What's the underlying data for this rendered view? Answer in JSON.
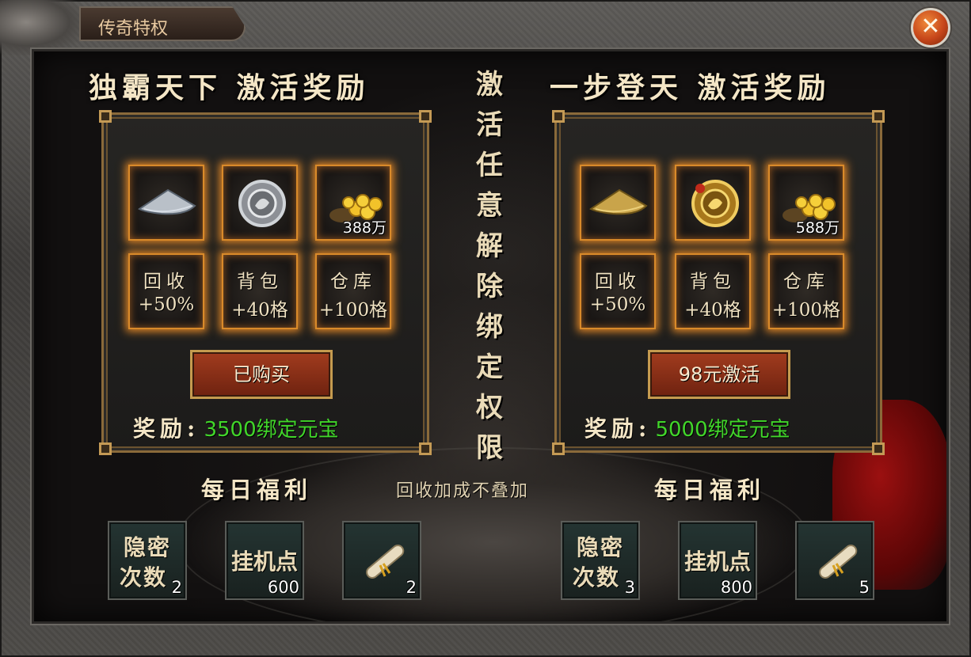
{
  "window": {
    "title": "传奇特权",
    "close_icon": "close-x-icon"
  },
  "center_notice": [
    "激",
    "活",
    "任",
    "意",
    "解",
    "除",
    "绑",
    "定",
    "权",
    "限"
  ],
  "note": "回收加成不叠加",
  "panels": [
    {
      "title": "独霸天下 激活奖励",
      "items": [
        {
          "icon": "silver-hat-icon"
        },
        {
          "icon": "silver-medal-icon"
        },
        {
          "icon": "gold-coins-icon",
          "amount": "388万"
        }
      ],
      "perks": [
        {
          "line1": "回收",
          "line2": "+50%"
        },
        {
          "line1": "背包",
          "line2": "+40格"
        },
        {
          "line1": "仓库",
          "line2": "+100格"
        }
      ],
      "button": "已购买",
      "reward_label": "奖励:",
      "reward_value": "3500绑定元宝",
      "daily_title": "每日福利",
      "daily": [
        {
          "line1": "隐密",
          "line2": "次数",
          "count": "2"
        },
        {
          "line1": "挂机点",
          "count": "600"
        },
        {
          "icon": "scroll-icon",
          "count": "2"
        }
      ]
    },
    {
      "title": "一步登天 激活奖励",
      "items": [
        {
          "icon": "gold-hat-icon"
        },
        {
          "icon": "gold-medal-icon"
        },
        {
          "icon": "gold-coins-icon",
          "amount": "588万"
        }
      ],
      "perks": [
        {
          "line1": "回收",
          "line2": "+50%"
        },
        {
          "line1": "背包",
          "line2": "+40格"
        },
        {
          "line1": "仓库",
          "line2": "+100格"
        }
      ],
      "button": "98元激活",
      "reward_label": "奖励:",
      "reward_value": "5000绑定元宝",
      "daily_title": "每日福利",
      "daily": [
        {
          "line1": "隐密",
          "line2": "次数",
          "count": "3"
        },
        {
          "line1": "挂机点",
          "count": "800"
        },
        {
          "icon": "scroll-icon",
          "count": "5"
        }
      ]
    }
  ],
  "colors": {
    "reward_green": "#41d62a",
    "glow_orange": "#d98a2a",
    "button_red": "#a23c1e"
  }
}
